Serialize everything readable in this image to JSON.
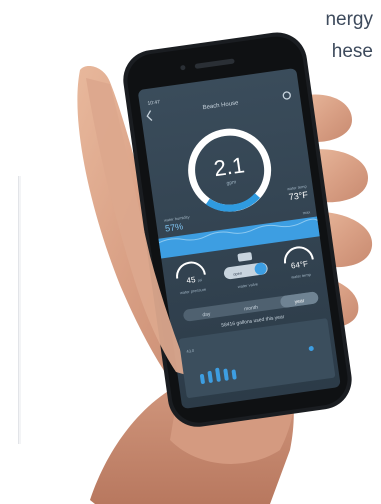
{
  "background_text": {
    "line1": "nergy",
    "line2": "hese"
  },
  "app": {
    "status_time": "10:47",
    "title": "Beach House",
    "back_icon": "chevron-left-icon",
    "settings_icon": "gear-icon",
    "flow_value": "2.1",
    "flow_unit": "gpm",
    "humidity_label": "water humidity",
    "humidity_value": "57%",
    "temp_label": "water temp",
    "temp_value": "73°F",
    "max_label": "max",
    "pressure_value": "45",
    "pressure_unit": "psi",
    "pressure_label": "water pressure",
    "valve_label": "water valve",
    "valve_state": "open",
    "water_temp_value": "64°F",
    "water_temp_label": "water temp",
    "tabs": [
      "day",
      "month",
      "year"
    ],
    "selected_tab": "year",
    "usage_text": "58416 gallons used this year",
    "graph_label": "43.0",
    "colors": {
      "screen": "#344553",
      "ring": "#ffffff",
      "ring_fill": "#2f9be0",
      "accent": "#3d9ee2"
    }
  }
}
